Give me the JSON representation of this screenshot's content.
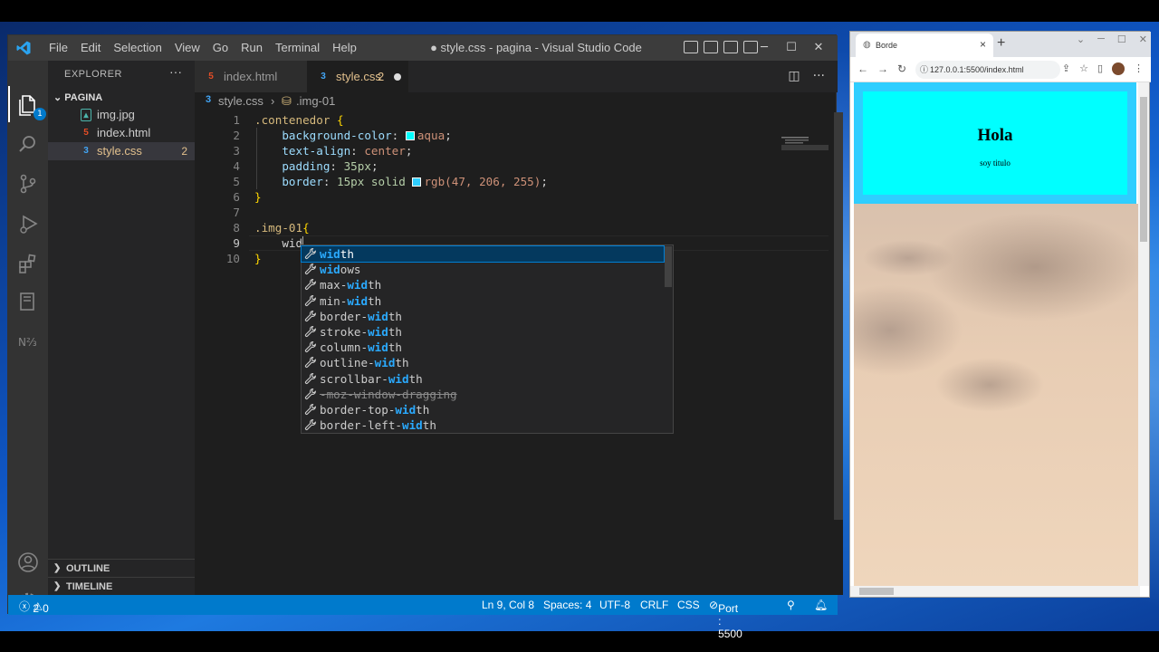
{
  "vscode": {
    "menu": [
      "File",
      "Edit",
      "Selection",
      "View",
      "Go",
      "Run",
      "Terminal",
      "Help"
    ],
    "window_title": "● style.css - pagina - Visual Studio Code",
    "activity_badge": "1",
    "explorer": {
      "header": "EXPLORER",
      "more": "···",
      "folder": "PAGINA",
      "files": [
        {
          "name": "img.jpg",
          "icon": "image-icon"
        },
        {
          "name": "index.html",
          "icon": "html-icon"
        },
        {
          "name": "style.css",
          "icon": "css-icon",
          "badge": "2"
        }
      ],
      "sections": [
        "OUTLINE",
        "TIMELINE"
      ]
    },
    "tabs": [
      {
        "label": "index.html"
      },
      {
        "label": "style.css",
        "badge": "2"
      }
    ],
    "breadcrumb": {
      "file": "style.css",
      "symbol": ".img-01"
    },
    "code": {
      "line_numbers": [
        "1",
        "2",
        "3",
        "4",
        "5",
        "6",
        "7",
        "8",
        "9",
        "10"
      ],
      "l1_selector": ".contenedor",
      "l2_prop": "background-color",
      "l2_val": "aqua",
      "l3_prop": "text-align",
      "l3_val": "center",
      "l4_prop": "padding",
      "l4_val": "35px",
      "l5_prop": "border",
      "l5_val1": "15px solid",
      "l5_val2": "rgb(47, 206, 255)",
      "l8_selector": ".img-01",
      "l9_text": "wid"
    },
    "suggestions": [
      {
        "pre": "",
        "match": "wid",
        "post": "th"
      },
      {
        "pre": "",
        "match": "wid",
        "post": "ows"
      },
      {
        "pre": "max-",
        "match": "wid",
        "post": "th"
      },
      {
        "pre": "min-",
        "match": "wid",
        "post": "th"
      },
      {
        "pre": "border-",
        "match": "wid",
        "post": "th"
      },
      {
        "pre": "stroke-",
        "match": "wid",
        "post": "th"
      },
      {
        "pre": "column-",
        "match": "wid",
        "post": "th"
      },
      {
        "pre": "outline-",
        "match": "wid",
        "post": "th"
      },
      {
        "pre": "scrollbar-",
        "match": "wid",
        "post": "th"
      },
      {
        "pre": "-moz-window-dragging",
        "match": "",
        "post": "",
        "deprecated": true
      },
      {
        "pre": "border-top-",
        "match": "wid",
        "post": "th"
      },
      {
        "pre": "border-left-",
        "match": "wid",
        "post": "th"
      }
    ],
    "status": {
      "errors": "2",
      "warnings": "0",
      "position": "Ln 9, Col 8",
      "spaces": "Spaces: 4",
      "encoding": "UTF-8",
      "eol": "CRLF",
      "language": "CSS",
      "port": "Port : 5500"
    },
    "colors": {
      "accent": "#007acc",
      "aqua": "#00ffff",
      "border_color": "#2fceff"
    }
  },
  "browser": {
    "tab_title": "Borde",
    "url": "127.0.0.1:5500/index.html",
    "page": {
      "heading": "Hola",
      "subtitle": "soy titulo"
    }
  }
}
